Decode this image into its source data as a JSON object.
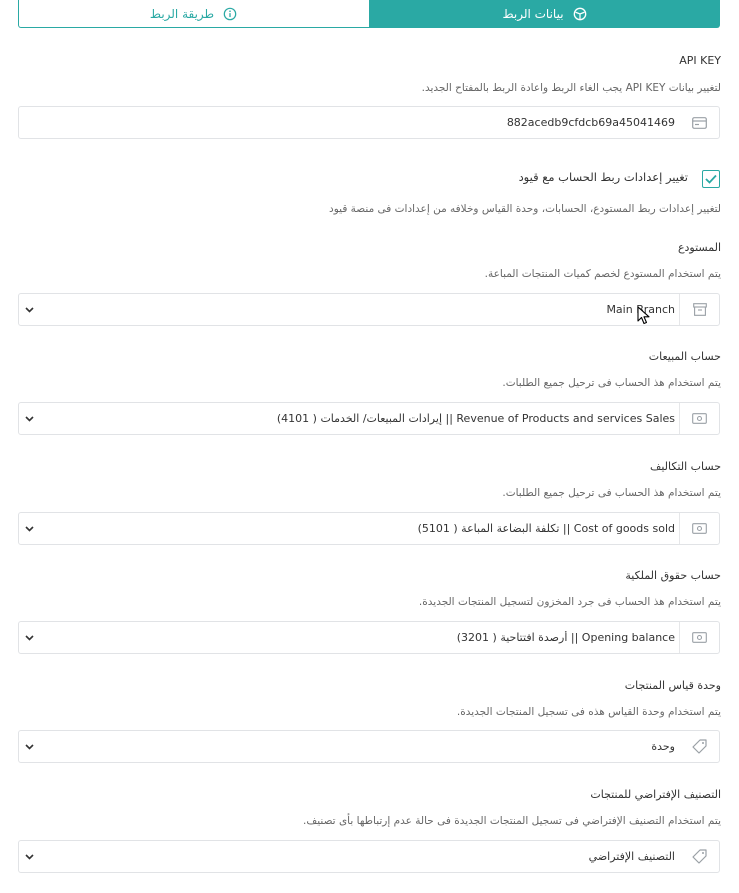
{
  "tabs": {
    "active_label": "بيانات الربط",
    "inactive_label": "طريقة الربط"
  },
  "api_key": {
    "label": "API KEY",
    "help": "لتغيير بيانات API KEY يجب الغاء الربط واعادة الربط بالمفتاح الجديد.",
    "value": "882acedb9cfdcb69a45041469"
  },
  "restrictions": {
    "checkbox_label": "تغيير إعدادات ربط الحساب مع قيود",
    "checked": true,
    "help": "لتغيير إعدادات ربط المستودع، الحسابات، وحدة القياس وخلافه من إعدادات فى منصة قيود"
  },
  "warehouse": {
    "label": "المستودع",
    "help": "يتم استخدام المستودع لخصم كميات المنتجات المباعة.",
    "value": "Main Branch"
  },
  "sales_account": {
    "label": "حساب المبيعات",
    "help": "يتم استخدام هذ الحساب فى ترحيل جميع الطلبات.",
    "value": "Revenue of Products and services Sales || إيرادات المبيعات/ الخدمات ( 4101)"
  },
  "cost_account": {
    "label": "حساب التكاليف",
    "help": "يتم استخدام هذ الحساب فى ترحيل جميع الطلبات.",
    "value": "Cost of goods sold || تكلفة البضاعة المباعة ( 5101)"
  },
  "equity_account": {
    "label": "حساب حقوق الملكية",
    "help": "يتم استخدام هذ الحساب فى جرد المخزون لتسجيل المنتجات الجديدة.",
    "value": "Opening balance || أرصدة افتتاحية ( 3201)"
  },
  "unit": {
    "label": "وحدة قياس المنتجات",
    "help": "يتم استخدام وحدة القياس هذه فى تسجيل المنتجات الجديدة.",
    "value": "وحدة"
  },
  "category": {
    "label": "التصنيف الإفتراضي للمنتجات",
    "help": "يتم استخدام التصنيف الإفتراضي فى تسجيل المنتجات الجديدة فى حالة عدم إرتباطها بأى تصنيف.",
    "value": "التصنيف الإفتراضي"
  },
  "colors": {
    "accent": "#2aa9a4",
    "border": "#e1e3e6",
    "text": "#333333",
    "muted": "#666666"
  },
  "icons": {
    "active_tab": "link-icon",
    "inactive_tab": "info-icon",
    "api_key": "card-icon",
    "warehouse": "archive-icon",
    "account": "money-icon",
    "tag": "tag-icon",
    "dropdown": "chevron-down-icon"
  }
}
